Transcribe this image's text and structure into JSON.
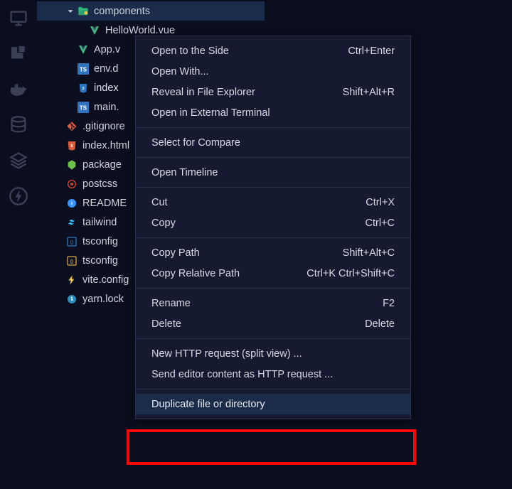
{
  "activity_icons": [
    "monitor-icon",
    "extensions-icon",
    "docker-icon",
    "database-icon",
    "layers-icon",
    "thunder-icon"
  ],
  "explorer": {
    "rows": [
      {
        "indent": 40,
        "expander": true,
        "icon": "folder-components-icon",
        "icon_color": "#33b679",
        "label": "components",
        "selected": true
      },
      {
        "indent": 72,
        "expander": false,
        "icon": "vue-file-icon",
        "icon_color": "#33b679",
        "label": "HelloWorld.vue"
      },
      {
        "indent": 56,
        "expander": false,
        "icon": "vue-file-icon",
        "icon_color": "#33b679",
        "label": "App.v"
      },
      {
        "indent": 56,
        "expander": false,
        "icon": "ts-file-icon",
        "icon_color": "#2f74c0",
        "label": "env.d"
      },
      {
        "indent": 56,
        "expander": false,
        "icon": "css-file-icon",
        "icon_color": "#2f74c0",
        "label": "index",
        "selected_row": true
      },
      {
        "indent": 56,
        "expander": false,
        "icon": "ts-file-icon",
        "icon_color": "#2f74c0",
        "label": "main."
      },
      {
        "indent": 40,
        "expander": false,
        "icon": "git-file-icon",
        "icon_color": "#e05d3b",
        "label": ".gitignore"
      },
      {
        "indent": 40,
        "expander": false,
        "icon": "html-file-icon",
        "icon_color": "#e05d3b",
        "label": "index.html"
      },
      {
        "indent": 40,
        "expander": false,
        "icon": "node-file-icon",
        "icon_color": "#6cc24a",
        "label": "package"
      },
      {
        "indent": 40,
        "expander": false,
        "icon": "postcss-file-icon",
        "icon_color": "#d6452f",
        "label": "postcss"
      },
      {
        "indent": 40,
        "expander": false,
        "icon": "readme-file-icon",
        "icon_color": "#3794ff",
        "label": "README"
      },
      {
        "indent": 40,
        "expander": false,
        "icon": "tailwind-file-icon",
        "icon_color": "#38bdf8",
        "label": "tailwind"
      },
      {
        "indent": 40,
        "expander": false,
        "icon": "tsconfig-file-icon",
        "icon_color": "#2f74c0",
        "label": "tsconfig"
      },
      {
        "indent": 40,
        "expander": false,
        "icon": "tsconfig-file-icon",
        "icon_color": "#d9a441",
        "label": "tsconfig"
      },
      {
        "indent": 40,
        "expander": false,
        "icon": "vite-file-icon",
        "icon_color": "#f6c945",
        "label": "vite.config"
      },
      {
        "indent": 40,
        "expander": false,
        "icon": "yarn-file-icon",
        "icon_color": "#2b8ebb",
        "label": "yarn.lock"
      }
    ]
  },
  "context_menu": {
    "groups": [
      [
        {
          "label": "Open to the Side",
          "shortcut": "Ctrl+Enter"
        },
        {
          "label": "Open With..."
        },
        {
          "label": "Reveal in File Explorer",
          "shortcut": "Shift+Alt+R"
        },
        {
          "label": "Open in External Terminal"
        }
      ],
      [
        {
          "label": "Select for Compare"
        }
      ],
      [
        {
          "label": "Open Timeline"
        }
      ],
      [
        {
          "label": "Cut",
          "shortcut": "Ctrl+X"
        },
        {
          "label": "Copy",
          "shortcut": "Ctrl+C"
        }
      ],
      [
        {
          "label": "Copy Path",
          "shortcut": "Shift+Alt+C"
        },
        {
          "label": "Copy Relative Path",
          "shortcut": "Ctrl+K Ctrl+Shift+C"
        }
      ],
      [
        {
          "label": "Rename",
          "shortcut": "F2"
        },
        {
          "label": "Delete",
          "shortcut": "Delete"
        }
      ],
      [
        {
          "label": "New HTTP request (split view) ..."
        },
        {
          "label": "Send editor content as HTTP request ..."
        }
      ],
      [
        {
          "label": "Duplicate file or directory",
          "highlight": true
        }
      ]
    ]
  }
}
